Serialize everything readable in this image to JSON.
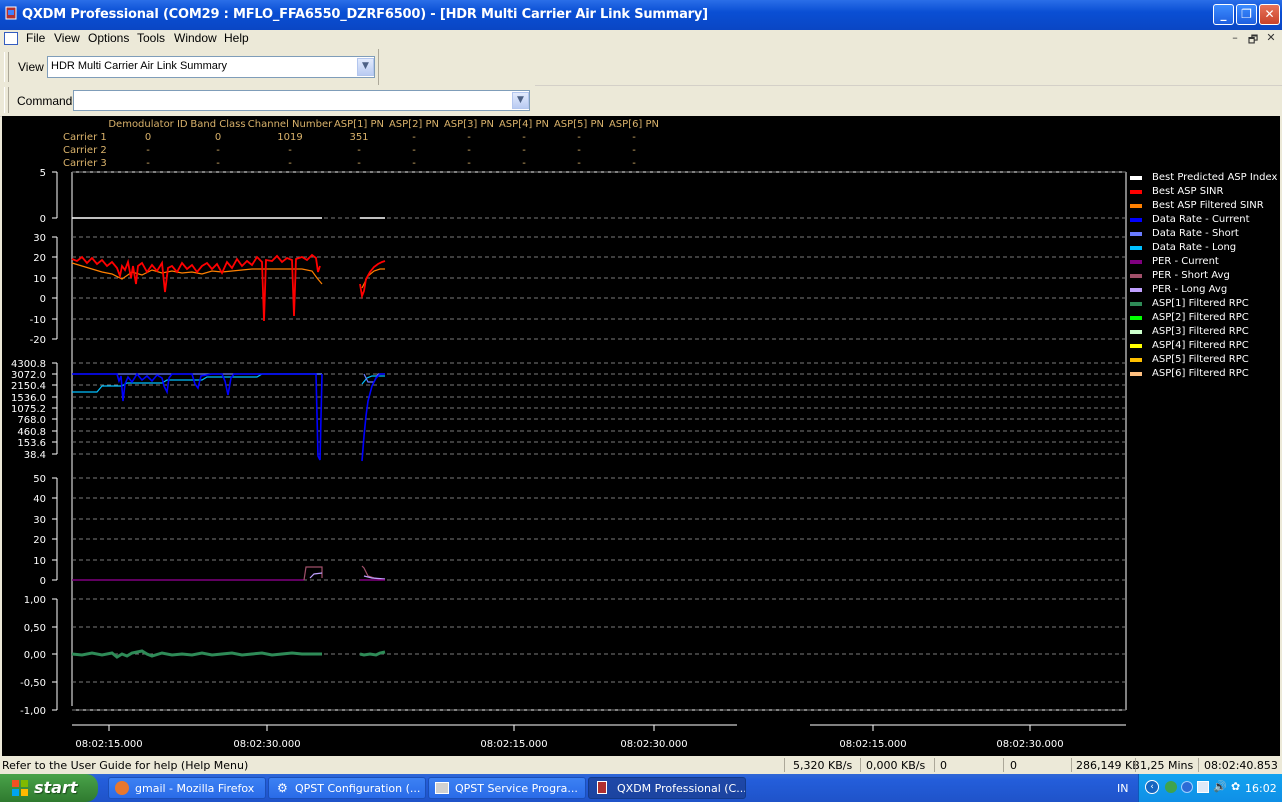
{
  "window": {
    "title": "QXDM Professional (COM29 : MFLO_FFA6550_DZRF6500) - [HDR Multi Carrier Air Link Summary]",
    "buttons": {
      "minimize": "_",
      "maximize": "❐",
      "close": "✕"
    }
  },
  "menu": {
    "items": [
      "File",
      "View",
      "Options",
      "Tools",
      "Window",
      "Help"
    ],
    "mdi_buttons": [
      "–",
      "🗗",
      "✕"
    ]
  },
  "view_bar": {
    "label": "View",
    "value": "HDR Multi Carrier Air Link Summary"
  },
  "command_bar": {
    "label": "Command",
    "value": ""
  },
  "carrier_table": {
    "headers": [
      "Demodulator ID",
      "Band Class",
      "Channel Number",
      "ASP[1] PN",
      "ASP[2] PN",
      "ASP[3] PN",
      "ASP[4] PN",
      "ASP[5] PN",
      "ASP[6] PN"
    ],
    "rows": [
      {
        "label": "Carrier 1",
        "cells": [
          "0",
          "0",
          "1019",
          "351",
          "-",
          "-",
          "-",
          "-",
          "-"
        ]
      },
      {
        "label": "Carrier 2",
        "cells": [
          "-",
          "-",
          "-",
          "-",
          "-",
          "-",
          "-",
          "-",
          "-"
        ]
      },
      {
        "label": "Carrier 3",
        "cells": [
          "-",
          "-",
          "-",
          "-",
          "-",
          "-",
          "-",
          "-",
          "-"
        ]
      }
    ]
  },
  "axes": {
    "asp_index": [
      "5",
      "0"
    ],
    "sinr": [
      "30",
      "20",
      "10",
      "0",
      "-10",
      "-20"
    ],
    "data_rate": [
      "4300.8",
      "3072.0",
      "2150.4",
      "1536.0",
      "1075.2",
      "768.0",
      "460.8",
      "153.6",
      "38.4"
    ],
    "per": [
      "50",
      "40",
      "30",
      "20",
      "10",
      "0"
    ],
    "rpc": [
      "1,00",
      "0,50",
      "0,00",
      "-0,50",
      "-1,00"
    ]
  },
  "time_labels": [
    {
      "text": "08:02:15.000"
    },
    {
      "text": "08:02:30.000"
    },
    {
      "text": "08:02:15.000"
    },
    {
      "text": "08:02:30.000"
    },
    {
      "text": "08:02:15.000"
    },
    {
      "text": "08:02:30.000"
    }
  ],
  "legend": [
    {
      "label": "Best Predicted ASP Index",
      "color": "#ffffff"
    },
    {
      "label": "Best ASP SINR",
      "color": "#ff0000"
    },
    {
      "label": "Best ASP Filtered SINR",
      "color": "#ff8000"
    },
    {
      "label": "Data Rate - Current",
      "color": "#0000ff"
    },
    {
      "label": "Data Rate - Short",
      "color": "#6a7cff"
    },
    {
      "label": "Data Rate - Long",
      "color": "#00c0ff"
    },
    {
      "label": "PER - Current",
      "color": "#800080"
    },
    {
      "label": "PER - Short Avg",
      "color": "#a0506a"
    },
    {
      "label": "PER - Long Avg",
      "color": "#c0a0ff"
    },
    {
      "label": "ASP[1] Filtered RPC",
      "color": "#2e8b57"
    },
    {
      "label": "ASP[2] Filtered RPC",
      "color": "#00ff00"
    },
    {
      "label": "ASP[3] Filtered RPC",
      "color": "#ccffcc"
    },
    {
      "label": "ASP[4] Filtered RPC",
      "color": "#ffff00"
    },
    {
      "label": "ASP[5] Filtered RPC",
      "color": "#ffc000"
    },
    {
      "label": "ASP[6] Filtered RPC",
      "color": "#ffc080"
    }
  ],
  "status": {
    "help": "Refer to the User Guide for help (Help Menu)",
    "rate_in": "5,320 KB/s",
    "rate_out": "0,000 KB/s",
    "c1": "0",
    "c2": "0",
    "size": "286,149 KB",
    "duration": "1,25 Mins",
    "time": "08:02:40.853"
  },
  "taskbar": {
    "start": "start",
    "tasks": [
      "gmail - Mozilla Firefox",
      "QPST Configuration (...",
      "QPST Service Progra...",
      "QXDM Professional (C..."
    ],
    "lang": "IN",
    "clock": "16:02"
  }
}
